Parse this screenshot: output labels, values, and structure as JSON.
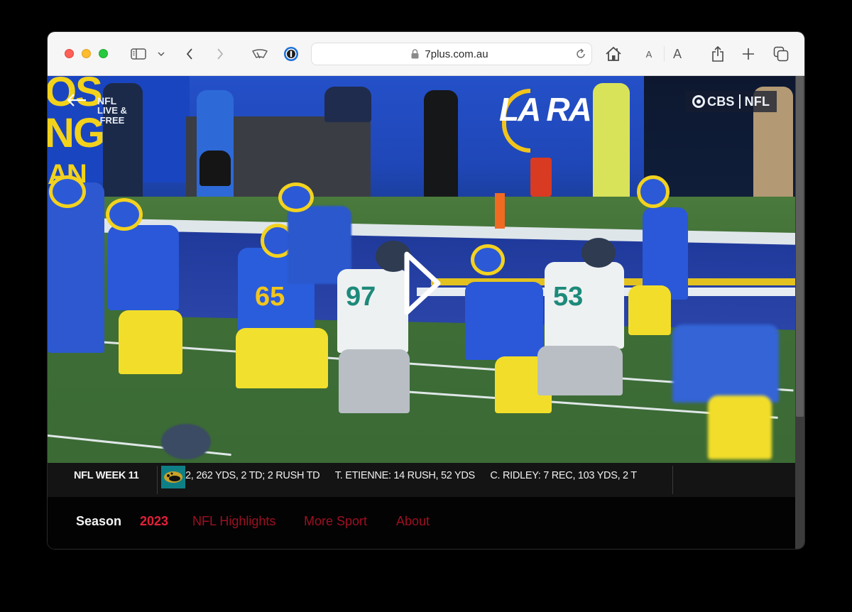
{
  "browser": {
    "address_bar": {
      "url": "7plus.com.au",
      "secure": true
    },
    "toolbar_icons": {
      "sidebar": "sidebar-icon",
      "tab_group_menu": "chevron-down-icon",
      "back": "chevron-left-icon",
      "forward": "chevron-right-icon",
      "extension_1": "windshield-wiper-icon",
      "extension_2": "password-manager-icon",
      "reload": "reload-icon",
      "home": "home-icon",
      "share": "share-icon",
      "new_tab": "plus-icon",
      "tab_overview": "tabs-overview-icon"
    },
    "text_size_small": "A",
    "text_size_large": "A"
  },
  "video": {
    "back_icon": "arrow-left-icon",
    "channel_badge": {
      "line1": "NFL",
      "line2": "LIVE &",
      "line3": "FREE"
    },
    "broadcaster_bug": {
      "left": "CBS",
      "right": "NFL"
    },
    "play_icon": "play-icon",
    "scene": {
      "jersey_numbers": [
        "65",
        "97",
        "53"
      ],
      "wall_sign": "LA RA"
    }
  },
  "ticker": {
    "label": "NFL WEEK 11",
    "team_logo": "jaguars-logo-icon",
    "items": [
      "2, 262 YDS, 2 TD; 2 RUSH TD",
      "T. ETIENNE: 14 RUSH, 52 YDS",
      "C. RIDLEY: 7 REC, 103 YDS, 2 T"
    ]
  },
  "nav": {
    "label": "Season",
    "items": [
      {
        "label": "2023",
        "active": true
      },
      {
        "label": "NFL Highlights",
        "active": false
      },
      {
        "label": "More Sport",
        "active": false
      },
      {
        "label": "About",
        "active": false
      }
    ]
  },
  "colors": {
    "nav_active": "#e2203a",
    "nav_inactive": "#9d1023",
    "ticker_bg": "#141414",
    "page_bg": "#000000"
  }
}
